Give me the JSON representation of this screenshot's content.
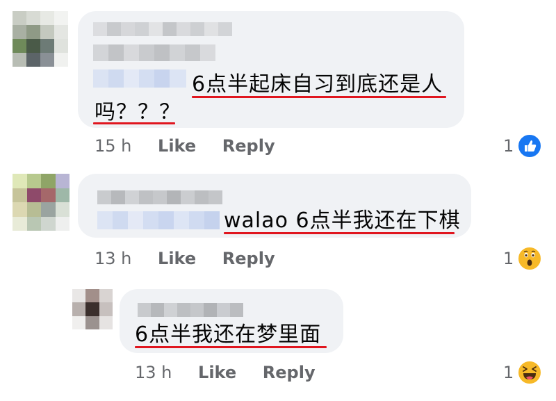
{
  "comments": [
    {
      "text_line1": "6点半起床自习到底还是人",
      "text_line2": "吗？？？",
      "time": "15 h",
      "like_label": "Like",
      "reply_label": "Reply",
      "reaction_count": "1",
      "reaction_icon": "thumbs-up-reaction-icon"
    },
    {
      "text_line1": "walao 6点半我还在下棋",
      "time": "13 h",
      "like_label": "Like",
      "reply_label": "Reply",
      "reaction_count": "1",
      "reaction_icon": "wow-reaction-icon"
    },
    {
      "text_line1": "6点半我还在梦里面",
      "time": "13 h",
      "like_label": "Like",
      "reply_label": "Reply",
      "reaction_count": "1",
      "reaction_icon": "haha-reaction-icon"
    }
  ],
  "colors": {
    "bubble": "#f0f2f5",
    "meta_text": "#65676b",
    "underline": "#e0161f",
    "like_blue": "#1877f2",
    "emoji_yellow": "#f7b928"
  }
}
